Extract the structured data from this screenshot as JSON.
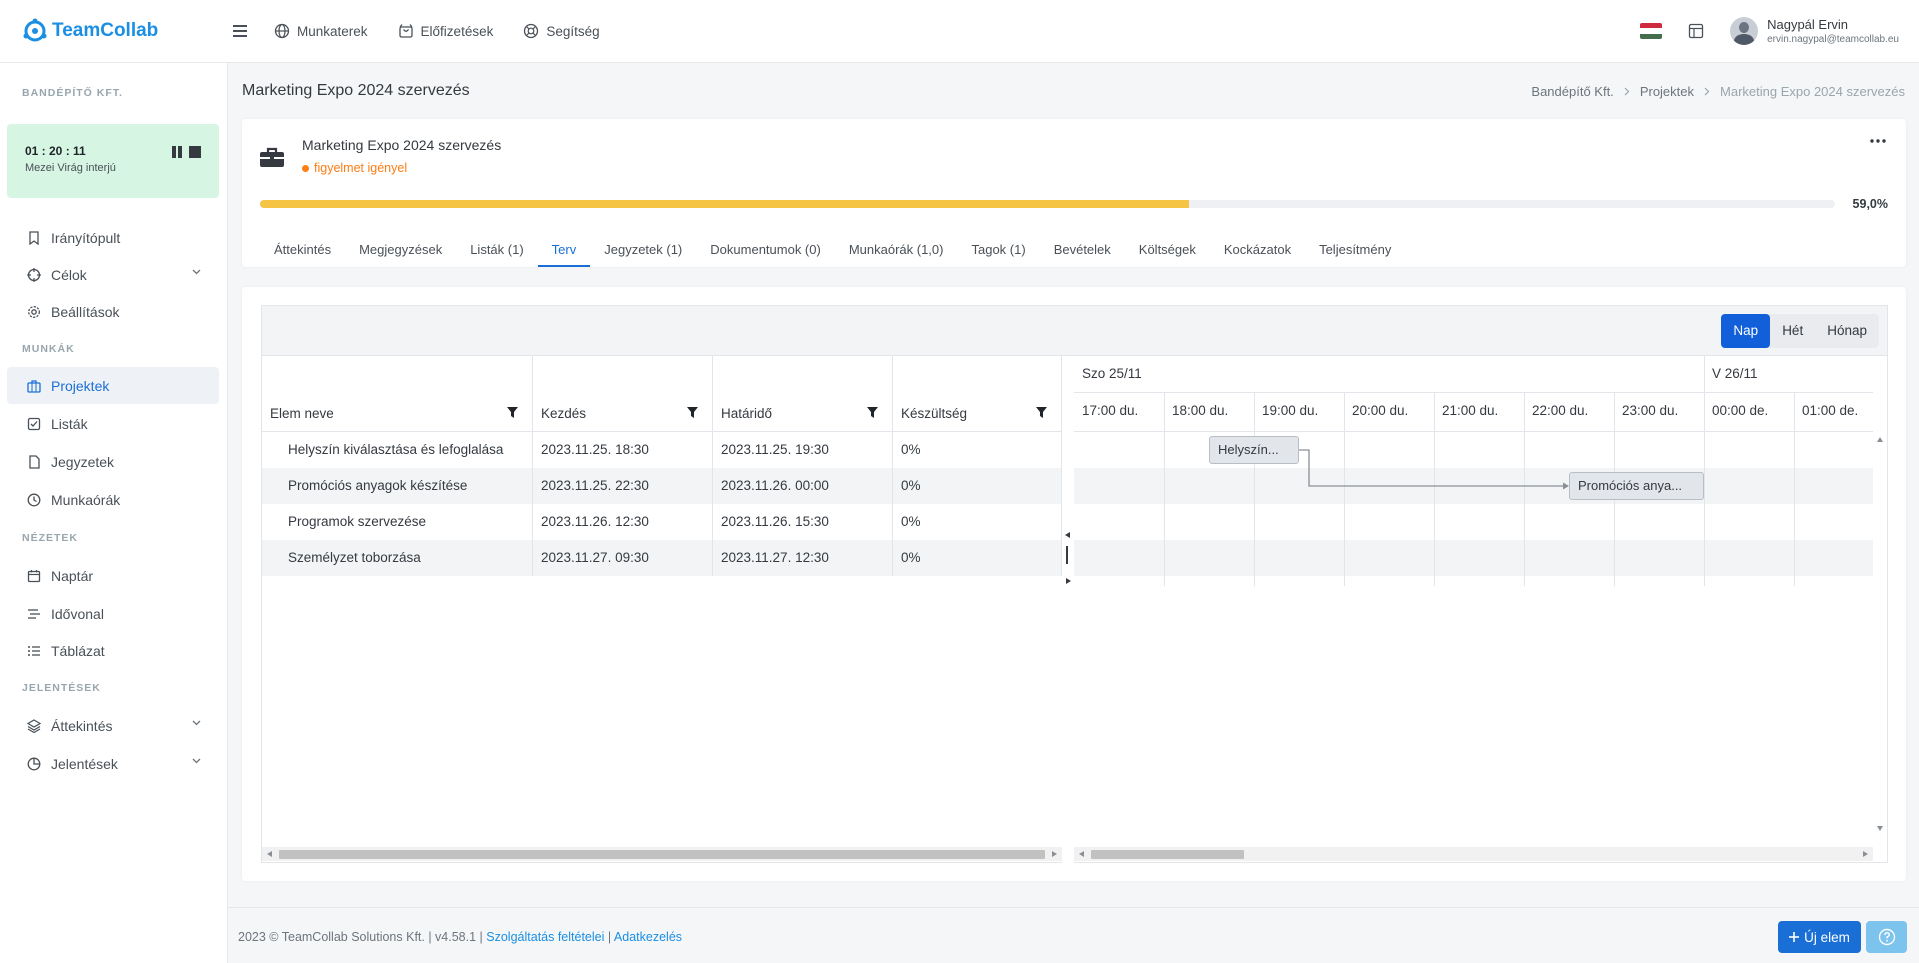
{
  "app": {
    "logo_text": "TeamCollab"
  },
  "topnav": [
    {
      "label": "Munkaterek",
      "icon": "globe-icon"
    },
    {
      "label": "Előfizetések",
      "icon": "bag-icon"
    },
    {
      "label": "Segítség",
      "icon": "lifebuoy-icon"
    }
  ],
  "user": {
    "name": "Nagypál Ervin",
    "email": "ervin.nagypal@teamcollab.eu"
  },
  "flag_colors": [
    "#cd2a3e",
    "#ffffff",
    "#436f4d"
  ],
  "sidebar": {
    "company": "BANDÉPÍTŐ KFT.",
    "timer": {
      "time": "01 : 20 : 11",
      "label": "Mezei Virág interjú"
    },
    "items": [
      {
        "label": "Irányítópult",
        "icon": "bookmark-icon"
      },
      {
        "label": "Célok",
        "icon": "target-icon"
      },
      {
        "label": "Beállítások",
        "icon": "gear-icon"
      },
      {
        "label": "Projektek",
        "icon": "briefcase-icon"
      },
      {
        "label": "Listák",
        "icon": "checkbox-icon"
      },
      {
        "label": "Jegyzetek",
        "icon": "file-icon"
      },
      {
        "label": "Munkaórák",
        "icon": "clock-icon"
      },
      {
        "label": "Naptár",
        "icon": "calendar-icon"
      },
      {
        "label": "Idővonal",
        "icon": "timeline-icon"
      },
      {
        "label": "Táblázat",
        "icon": "list-icon"
      },
      {
        "label": "Áttekintés",
        "icon": "layers-icon"
      },
      {
        "label": "Jelentések",
        "icon": "piechart-icon"
      }
    ],
    "sections": {
      "munkak": "MUNKÁK",
      "nezetek": "NÉZETEK",
      "jelentesek": "JELENTÉSEK"
    }
  },
  "page": {
    "title": "Marketing Expo 2024 szervezés",
    "breadcrumb": [
      "Bandépítő Kft.",
      "Projektek",
      "Marketing Expo 2024 szervezés"
    ]
  },
  "project": {
    "name": "Marketing Expo 2024 szervezés",
    "status": "figyelmet igényel",
    "status_color": "#fd7e14",
    "progress": 59.0,
    "progress_label": "59,0%",
    "progress_color": "#f5c445",
    "tabs": [
      "Áttekintés",
      "Megjegyzések",
      "Listák (1)",
      "Terv",
      "Jegyzetek (1)",
      "Dokumentumok (0)",
      "Munkaórák (1,0)",
      "Tagok (1)",
      "Bevételek",
      "Költségek",
      "Kockázatok",
      "Teljesítmény"
    ],
    "active_tab": "Terv"
  },
  "gantt": {
    "views": [
      "Nap",
      "Hét",
      "Hónap"
    ],
    "active_view": "Nap",
    "columns": [
      "Elem neve",
      "Kezdés",
      "Határidő",
      "Készültség"
    ],
    "rows": [
      {
        "name": "Helyszín kiválasztása és lefoglalása",
        "start": "2023.11.25. 18:30",
        "end": "2023.11.25. 19:30",
        "progress": "0%"
      },
      {
        "name": "Promóciós anyagok készítése",
        "start": "2023.11.25. 22:30",
        "end": "2023.11.26. 00:00",
        "progress": "0%"
      },
      {
        "name": "Programok szervezése",
        "start": "2023.11.26. 12:30",
        "end": "2023.11.26. 15:30",
        "progress": "0%"
      },
      {
        "name": "Személyzet toborzása",
        "start": "2023.11.27. 09:30",
        "end": "2023.11.27. 12:30",
        "progress": "0%"
      }
    ],
    "days": [
      "Szo 25/11",
      "V 26/11"
    ],
    "hours": [
      "17:00 du.",
      "18:00 du.",
      "19:00 du.",
      "20:00 du.",
      "21:00 du.",
      "22:00 du.",
      "23:00 du.",
      "00:00 de.",
      "01:00 de."
    ],
    "bars": [
      "Helyszín...",
      "Promóciós anya..."
    ]
  },
  "footer": {
    "copyright": "2023 © TeamCollab Solutions Kft. | v4.58.1 | ",
    "terms": "Szolgáltatás feltételei",
    "sep": " | ",
    "privacy": "Adatkezelés",
    "new_button": "Új elem"
  }
}
